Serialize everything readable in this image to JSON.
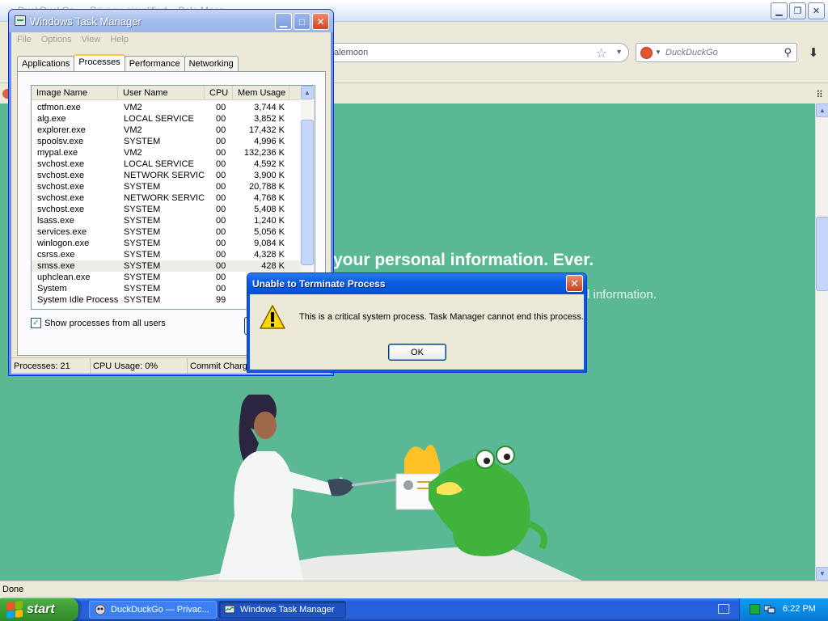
{
  "browser": {
    "window_title": "DuckDuckGo — Privacy, simplified. - Pale Moon",
    "url_text": "alemoon",
    "search_engine": "DuckDuckGo",
    "status": "Done",
    "page": {
      "headline": "your personal information. Ever.",
      "subtext": "l information."
    }
  },
  "taskmgr": {
    "title": "Windows Task Manager",
    "menus": [
      "File",
      "Options",
      "View",
      "Help"
    ],
    "tabs": [
      "Applications",
      "Processes",
      "Performance",
      "Networking"
    ],
    "active_tab": "Processes",
    "columns": [
      "Image Name",
      "User Name",
      "CPU",
      "Mem Usage"
    ],
    "processes": [
      {
        "name": "ctfmon.exe",
        "user": "VM2",
        "cpu": "00",
        "mem": "3,744 K"
      },
      {
        "name": "alg.exe",
        "user": "LOCAL SERVICE",
        "cpu": "00",
        "mem": "3,852 K"
      },
      {
        "name": "explorer.exe",
        "user": "VM2",
        "cpu": "00",
        "mem": "17,432 K"
      },
      {
        "name": "spoolsv.exe",
        "user": "SYSTEM",
        "cpu": "00",
        "mem": "4,996 K"
      },
      {
        "name": "mypal.exe",
        "user": "VM2",
        "cpu": "00",
        "mem": "132,236 K"
      },
      {
        "name": "svchost.exe",
        "user": "LOCAL SERVICE",
        "cpu": "00",
        "mem": "4,592 K"
      },
      {
        "name": "svchost.exe",
        "user": "NETWORK SERVICE",
        "cpu": "00",
        "mem": "3,900 K"
      },
      {
        "name": "svchost.exe",
        "user": "SYSTEM",
        "cpu": "00",
        "mem": "20,788 K"
      },
      {
        "name": "svchost.exe",
        "user": "NETWORK SERVICE",
        "cpu": "00",
        "mem": "4,768 K"
      },
      {
        "name": "svchost.exe",
        "user": "SYSTEM",
        "cpu": "00",
        "mem": "5,408 K"
      },
      {
        "name": "lsass.exe",
        "user": "SYSTEM",
        "cpu": "00",
        "mem": "1,240 K"
      },
      {
        "name": "services.exe",
        "user": "SYSTEM",
        "cpu": "00",
        "mem": "5,056 K"
      },
      {
        "name": "winlogon.exe",
        "user": "SYSTEM",
        "cpu": "00",
        "mem": "9,084 K"
      },
      {
        "name": "csrss.exe",
        "user": "SYSTEM",
        "cpu": "00",
        "mem": "4,328 K"
      },
      {
        "name": "smss.exe",
        "user": "SYSTEM",
        "cpu": "00",
        "mem": "428 K",
        "selected": true
      },
      {
        "name": "uphclean.exe",
        "user": "SYSTEM",
        "cpu": "00",
        "mem": ""
      },
      {
        "name": "System",
        "user": "SYSTEM",
        "cpu": "00",
        "mem": ""
      },
      {
        "name": "System Idle Process",
        "user": "SYSTEM",
        "cpu": "99",
        "mem": ""
      }
    ],
    "show_all_label": "Show processes from all users",
    "show_all_checked": true,
    "status": {
      "processes": "Processes: 21",
      "cpu": "CPU Usage: 0%",
      "commit": "Commit Charge"
    }
  },
  "error_dialog": {
    "title": "Unable to Terminate Process",
    "message": "This is a critical system process.  Task Manager cannot end this process.",
    "ok_label": "OK"
  },
  "taskbar": {
    "start_label": "start",
    "tasks": [
      {
        "label": "DuckDuckGo — Privac...",
        "active": false
      },
      {
        "label": "Windows Task Manager",
        "active": true
      }
    ],
    "clock": "6:22 PM"
  },
  "colors": {
    "page_bg": "#5bb894",
    "xp_blue": "#0a5fe0",
    "start_green": "#3c9b34"
  }
}
